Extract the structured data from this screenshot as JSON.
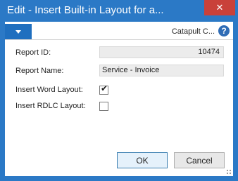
{
  "window": {
    "title": "Edit - Insert Built-in Layout for a...",
    "close_glyph": "✕"
  },
  "ribbon": {
    "company": "Catapult C...",
    "help_glyph": "?"
  },
  "form": {
    "report_id_label": "Report ID:",
    "report_id_value": "10474",
    "report_name_label": "Report Name:",
    "report_name_value": "Service - Invoice",
    "insert_word_label": "Insert Word Layout:",
    "insert_word_checked": true,
    "insert_word_tick": "✔",
    "insert_rdlc_label": "Insert RDLC Layout:",
    "insert_rdlc_checked": false
  },
  "buttons": {
    "ok": "OK",
    "cancel": "Cancel"
  },
  "colors": {
    "title_bar": "#2b79c6",
    "close_button": "#c9413a",
    "menu_button": "#1f6fbf"
  }
}
